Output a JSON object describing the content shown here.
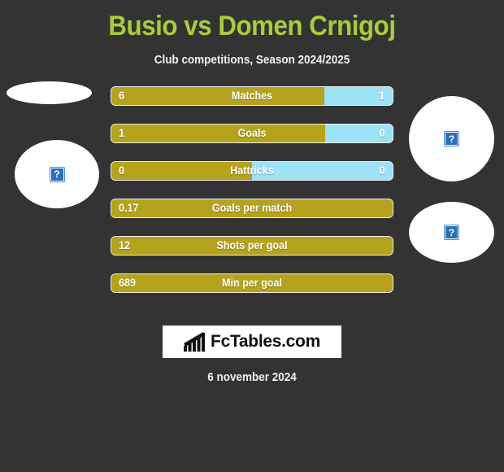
{
  "header": {
    "title": "Busio vs Domen Crnigoj",
    "subtitle": "Club competitions, Season 2024/2025",
    "title_color": "#a8cc3c"
  },
  "colors": {
    "background": "#333333",
    "home_bar": "#b5a31d",
    "away_bar": "#9ee2f8",
    "text": "#ffffff"
  },
  "players": {
    "left": {
      "name": "Busio",
      "photo_alt": "broken-image",
      "icon": "broken-image-icon"
    },
    "right": {
      "name": "Domen Crnigoj",
      "photo_alt": "broken-image",
      "icon": "broken-image-icon"
    },
    "broken_icon_glyph": "?"
  },
  "chart_data": {
    "type": "bar",
    "title": "Busio vs Domen Crnigoj",
    "subtitle": "Club competitions, Season 2024/2025",
    "orientation": "horizontal-diverging",
    "legend_position": "none",
    "grid": false,
    "series": [
      {
        "name": "Busio",
        "color": "#b5a31d"
      },
      {
        "name": "Domen Crnigoj",
        "color": "#9ee2f8"
      }
    ],
    "categories": [
      "Matches",
      "Goals",
      "Hattricks",
      "Goals per match",
      "Shots per goal",
      "Min per goal"
    ],
    "rows": [
      {
        "label": "Matches",
        "home": "6",
        "away": "1",
        "home_ratio": 0.758,
        "has_away": true
      },
      {
        "label": "Goals",
        "home": "1",
        "away": "0",
        "home_ratio": 0.76,
        "has_away": true
      },
      {
        "label": "Hattricks",
        "home": "0",
        "away": "0",
        "home_ratio": 0.5,
        "has_away": true
      },
      {
        "label": "Goals per match",
        "home": "0.17",
        "away": "",
        "home_ratio": 1.0,
        "has_away": false
      },
      {
        "label": "Shots per goal",
        "home": "12",
        "away": "",
        "home_ratio": 1.0,
        "has_away": false
      },
      {
        "label": "Min per goal",
        "home": "689",
        "away": "",
        "home_ratio": 1.0,
        "has_away": false
      }
    ]
  },
  "footer": {
    "logo_text": "FcTables.com",
    "logo_icon": "bar-chart-icon",
    "date": "6 november 2024"
  }
}
